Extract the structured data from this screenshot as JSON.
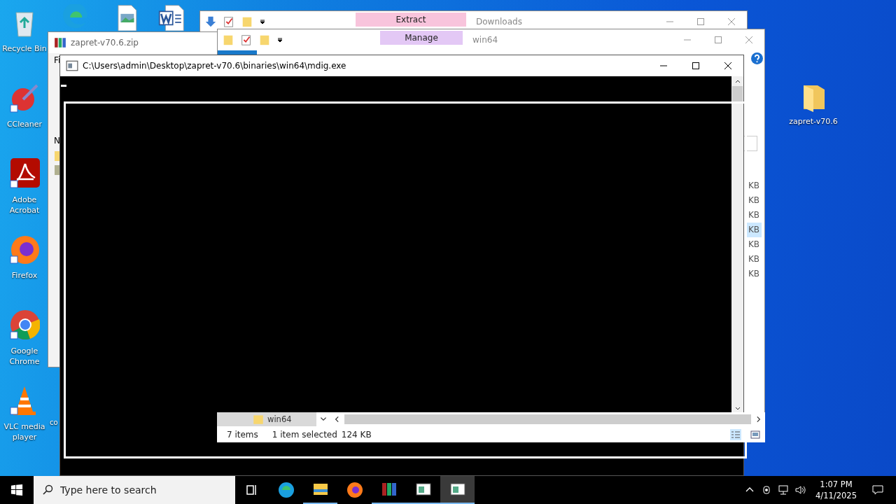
{
  "desktop": {
    "left_icons": [
      {
        "label": "Recycle Bin",
        "kind": "recycle"
      },
      {
        "label": "CCleaner",
        "kind": "ccleaner"
      },
      {
        "label": "Adobe Acrobat",
        "kind": "acrobat"
      },
      {
        "label": "Firefox",
        "kind": "firefox"
      },
      {
        "label": "Google Chrome",
        "kind": "chrome"
      },
      {
        "label": "VLC media player",
        "kind": "vlc"
      }
    ],
    "top_icons": [
      {
        "kind": "edge"
      },
      {
        "kind": "image"
      },
      {
        "kind": "word"
      }
    ],
    "partial_label": "co",
    "right_icon": {
      "label": "zapret-v70.6",
      "kind": "folder"
    }
  },
  "downloads_window": {
    "title": "Downloads",
    "ribbon_tab": "Extract"
  },
  "win64_window": {
    "title": "win64",
    "ribbon_tab": "Manage",
    "size_cells": [
      {
        "text": "KB",
        "selected": false
      },
      {
        "text": "KB",
        "selected": false
      },
      {
        "text": "KB",
        "selected": false
      },
      {
        "text": "KB",
        "selected": true
      },
      {
        "text": "KB",
        "selected": false
      },
      {
        "text": "KB",
        "selected": false
      },
      {
        "text": "KB",
        "selected": false
      }
    ],
    "nav_folder": "win64",
    "status": {
      "count": "7 items",
      "selection": "1 item selected",
      "size": "124 KB"
    }
  },
  "archive_window": {
    "title": "zapret-v70.6.zip",
    "menu": "Fi",
    "column": "N"
  },
  "console_window": {
    "title": "C:\\Users\\admin\\Desktop\\zapret-v70.6\\binaries\\win64\\mdig.exe"
  },
  "taskbar": {
    "search_placeholder": "Type here to search",
    "apps": [
      {
        "kind": "edge",
        "running": false,
        "active": false
      },
      {
        "kind": "explorer",
        "running": true,
        "active": false
      },
      {
        "kind": "firefox",
        "running": false,
        "active": false
      },
      {
        "kind": "winrar",
        "running": true,
        "active": false
      },
      {
        "kind": "console",
        "running": true,
        "active": false
      },
      {
        "kind": "console",
        "running": true,
        "active": true
      }
    ],
    "time": "1:07 PM",
    "date": "4/11/2025"
  }
}
